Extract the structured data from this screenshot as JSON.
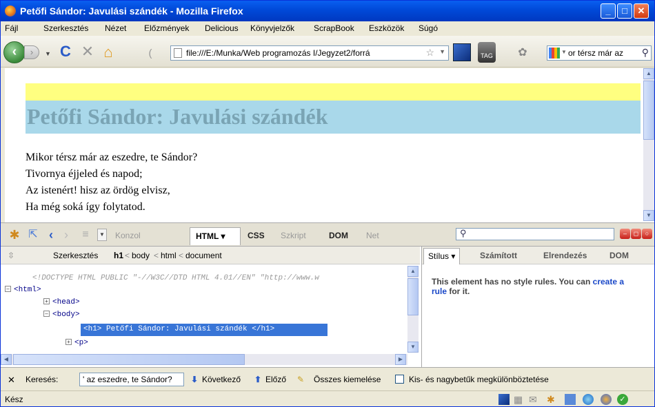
{
  "window": {
    "title": "Petőfi Sándor: Javulási szándék - Mozilla Firefox"
  },
  "menu": [
    "Fájl",
    "Szerkesztés",
    "Nézet",
    "Előzmények",
    "Delicious",
    "Könyvjelzők",
    "ScrapBook",
    "Eszközök",
    "Súgó"
  ],
  "nav": {
    "url": "file:///E:/Munka/Web programozás I/Jegyzet2/forrá",
    "search_value": "or térsz már az",
    "tag_label": "TAG"
  },
  "page": {
    "heading": "Petőfi Sándor: Javulási szándék",
    "poem": [
      "Mikor térsz már az eszedre, te Sándor?",
      "Tivornya éjjeled és napod;",
      "Az istenért! hisz az ördög elvisz,",
      "Ha még soká így folytatod."
    ]
  },
  "firebug": {
    "tabs": [
      "Konzol",
      "HTML ▾",
      "CSS",
      "Szkript",
      "DOM",
      "Net"
    ],
    "edit_label": "Szerkesztés",
    "breadcrumb": [
      "h1",
      "body",
      "html",
      "document"
    ],
    "tree": {
      "doctype": "<!DOCTYPE HTML PUBLIC \"-//W3C//DTD HTML 4.01//EN\" \"http://www.w",
      "html": "<html>",
      "head": "<head>",
      "body": "<body>",
      "selected": "<h1> Petőfi Sándor: Javulási szándék </h1>",
      "p": "<p>"
    },
    "side_tabs": [
      "Stílus ▾",
      "Számított",
      "Elrendezés",
      "DOM"
    ],
    "style_msg": "This element has no style rules. You can",
    "style_link": "create a rule",
    "style_msg_end": "for it."
  },
  "findbar": {
    "label": "Keresés:",
    "value": "' az eszedre, te Sándor?",
    "next": "Következő",
    "prev": "Előző",
    "highlight": "Összes kiemelése",
    "case": "Kis- és nagybetűk megkülönböztetése"
  },
  "status": {
    "text": "Kész"
  },
  "colors": {
    "title_bar": "#0049d8",
    "h1_bg": "#a9d8ea",
    "band_bg": "#ffff80",
    "selection": "#3875d7"
  }
}
